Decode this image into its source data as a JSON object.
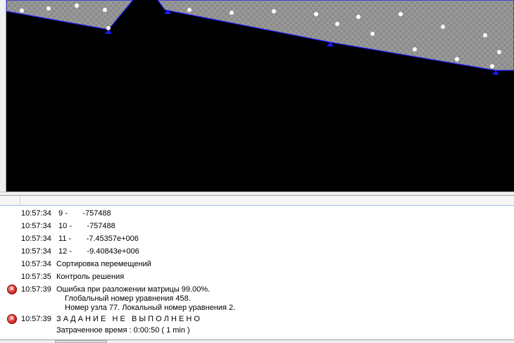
{
  "log": {
    "rows": [
      {
        "time": "10:57:34",
        "message": " 9 -       -757488"
      },
      {
        "time": "10:57:34",
        "message": " 10 -       -757488"
      },
      {
        "time": "10:57:34",
        "message": " 11 -       -7.45357e+006"
      },
      {
        "time": "10:57:34",
        "message": " 12 -       -9.40843e+006"
      },
      {
        "time": "10:57:34",
        "message": "Сортировка перемещений"
      },
      {
        "time": "10:57:35",
        "message": "Контроль решения"
      }
    ],
    "error1": {
      "time": "10:57:39",
      "message": "Ошибка при разложении матрицы 99.00%.",
      "line2": "Глобальный номер уравнения 458.",
      "line3": "Номер узла 77. Локальный номер уравнения 2."
    },
    "error2": {
      "time": "10:57:39",
      "message": "З А Д А Н И Е   Н Е   В Ы П О Л Н Е Н О",
      "line2": "Затраченное время : 0:00:50 ( 1 min )"
    }
  },
  "icons": {
    "error": "error-icon"
  },
  "colors": {
    "viewport_bg": "#000000",
    "mesh": "#8c8c8c",
    "mesh_edge": "#1a1aff",
    "error": "#d32f2f"
  }
}
